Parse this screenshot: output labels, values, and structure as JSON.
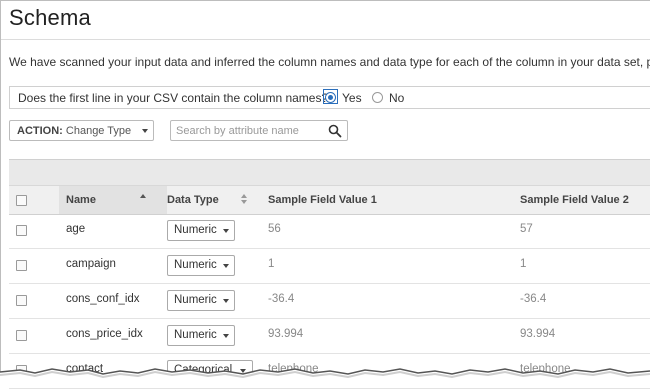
{
  "page": {
    "title": "Schema",
    "intro": "We have scanned your input data and inferred the column names and data type for each of the column in your data set, pleas"
  },
  "csv_header": {
    "question": "Does the first line in your CSV contain the column names?",
    "yes_label": "Yes",
    "no_label": "No",
    "selected": "Yes"
  },
  "toolbar": {
    "action_prefix": "ACTION:",
    "action_value": "Change Type",
    "search_placeholder": "Search by attribute name"
  },
  "table": {
    "columns": {
      "name": "Name",
      "data_type": "Data Type",
      "sample1": "Sample Field Value 1",
      "sample2": "Sample Field Value 2"
    },
    "rows": [
      {
        "name": "age",
        "type": "Numeric",
        "v1": "56",
        "v2": "57"
      },
      {
        "name": "campaign",
        "type": "Numeric",
        "v1": "1",
        "v2": "1"
      },
      {
        "name": "cons_conf_idx",
        "type": "Numeric",
        "v1": "-36.4",
        "v2": "-36.4"
      },
      {
        "name": "cons_price_idx",
        "type": "Numeric",
        "v1": "93.994",
        "v2": "93.994"
      },
      {
        "name": "contact",
        "type": "Categorical",
        "v1": "telephone",
        "v2": "telephone"
      }
    ]
  },
  "colors": {
    "accent": "#2a6ebb",
    "header_bg": "#f0f0f0",
    "band_bg": "#e9e9e9"
  },
  "icons": {
    "search": "search-icon",
    "dropdown": "chevron-down-icon",
    "sort": "sort-ascending-icon"
  }
}
